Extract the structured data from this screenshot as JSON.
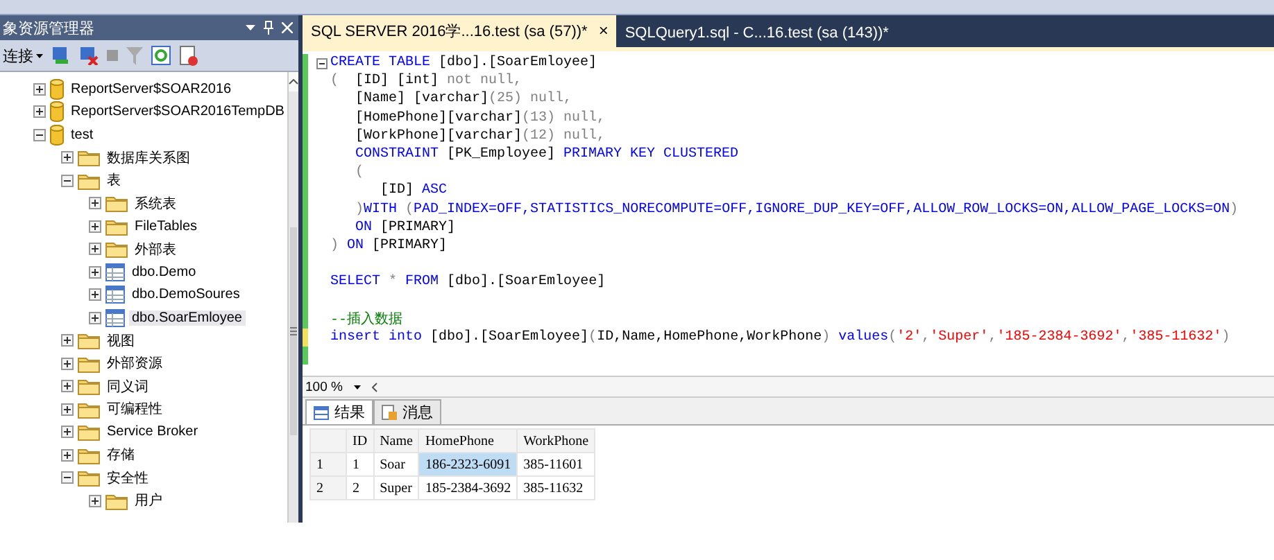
{
  "object_explorer": {
    "title": "象资源管理器",
    "connect_label": "连接",
    "tree": [
      {
        "label": "ReportServer$SOAR2016",
        "kind": "database",
        "expanded": false,
        "selected": false
      },
      {
        "label": "ReportServer$SOAR2016TempDB",
        "kind": "database",
        "expanded": false,
        "selected": false
      },
      {
        "label": "test",
        "kind": "database",
        "expanded": true,
        "selected": false,
        "children": [
          {
            "label": "数据库关系图",
            "kind": "folder",
            "expanded": false,
            "selected": false
          },
          {
            "label": "表",
            "kind": "folder",
            "expanded": true,
            "selected": false,
            "children": [
              {
                "label": "系统表",
                "kind": "folder",
                "expanded": false,
                "selected": false
              },
              {
                "label": "FileTables",
                "kind": "folder",
                "expanded": false,
                "selected": false
              },
              {
                "label": "外部表",
                "kind": "folder",
                "expanded": false,
                "selected": false
              },
              {
                "label": "dbo.Demo",
                "kind": "table",
                "expanded": false,
                "selected": false
              },
              {
                "label": "dbo.DemoSoures",
                "kind": "table",
                "expanded": false,
                "selected": false
              },
              {
                "label": "dbo.SoarEmloyee",
                "kind": "table",
                "expanded": false,
                "selected": true
              }
            ]
          },
          {
            "label": "视图",
            "kind": "folder",
            "expanded": false,
            "selected": false
          },
          {
            "label": "外部资源",
            "kind": "folder",
            "expanded": false,
            "selected": false
          },
          {
            "label": "同义词",
            "kind": "folder",
            "expanded": false,
            "selected": false
          },
          {
            "label": "可编程性",
            "kind": "folder",
            "expanded": false,
            "selected": false
          },
          {
            "label": "Service Broker",
            "kind": "folder",
            "expanded": false,
            "selected": false
          },
          {
            "label": "存储",
            "kind": "folder",
            "expanded": false,
            "selected": false
          },
          {
            "label": "安全性",
            "kind": "folder",
            "expanded": true,
            "selected": false,
            "children": [
              {
                "label": "用户",
                "kind": "folder",
                "expanded": false,
                "selected": false
              }
            ]
          }
        ]
      }
    ]
  },
  "tabs": [
    {
      "label": "SQL SERVER 2016学...16.test (sa (57))*",
      "close": "×",
      "selected": true
    },
    {
      "label": "SQLQuery1.sql - C...16.test (sa (143))*",
      "selected": false
    }
  ],
  "code_lines": [
    {
      "kind": "code",
      "saved": true,
      "tokens": [
        {
          "kind": "kw",
          "s": "CREATE TABLE"
        },
        {
          "kind": "plain",
          "s": " [dbo].[SoarEmloyee]"
        }
      ]
    },
    {
      "kind": "code",
      "saved": true,
      "tokens": [
        {
          "kind": "gray",
          "s": "(  "
        },
        {
          "kind": "plain",
          "s": "[ID] [int] "
        },
        {
          "kind": "gray",
          "s": "not null,"
        }
      ]
    },
    {
      "kind": "code",
      "saved": true,
      "tokens": [
        {
          "kind": "plain",
          "s": "   [Name] [varchar]"
        },
        {
          "kind": "gray",
          "s": "(25) null,"
        }
      ]
    },
    {
      "kind": "code",
      "saved": true,
      "tokens": [
        {
          "kind": "plain",
          "s": "   [HomePhone][varchar]"
        },
        {
          "kind": "gray",
          "s": "(13) null,"
        }
      ]
    },
    {
      "kind": "code",
      "saved": true,
      "tokens": [
        {
          "kind": "plain",
          "s": "   [WorkPhone][varchar]"
        },
        {
          "kind": "gray",
          "s": "(12) null,"
        }
      ]
    },
    {
      "kind": "code",
      "saved": true,
      "tokens": [
        {
          "kind": "kw",
          "s": "   CONSTRAINT"
        },
        {
          "kind": "plain",
          "s": " [PK_Employee] "
        },
        {
          "kind": "kw",
          "s": "PRIMARY KEY CLUSTERED"
        }
      ]
    },
    {
      "kind": "code",
      "saved": true,
      "tokens": [
        {
          "kind": "gray",
          "s": "   ("
        }
      ]
    },
    {
      "kind": "code",
      "saved": true,
      "tokens": [
        {
          "kind": "plain",
          "s": "      [ID] "
        },
        {
          "kind": "kw",
          "s": "ASC"
        }
      ]
    },
    {
      "kind": "code",
      "saved": true,
      "tokens": [
        {
          "kind": "gray",
          "s": "   )"
        },
        {
          "kind": "kw",
          "s": "WITH "
        },
        {
          "kind": "gray",
          "s": "("
        },
        {
          "kind": "kw",
          "s": "PAD_INDEX=OFF,STATISTICS_NORECOMPUTE=OFF,IGNORE_DUP_KEY=OFF,ALLOW_ROW_LOCKS=ON,ALLOW_PAGE_LOCKS=ON"
        },
        {
          "kind": "gray",
          "s": ")"
        }
      ]
    },
    {
      "kind": "code",
      "saved": true,
      "tokens": [
        {
          "kind": "kw",
          "s": "   ON"
        },
        {
          "kind": "plain",
          "s": " [PRIMARY]"
        }
      ]
    },
    {
      "kind": "code",
      "saved": true,
      "tokens": [
        {
          "kind": "gray",
          "s": ")"
        },
        {
          "kind": "kw",
          "s": " ON"
        },
        {
          "kind": "plain",
          "s": " [PRIMARY]"
        }
      ]
    },
    {
      "kind": "blank",
      "saved": true
    },
    {
      "kind": "code",
      "saved": true,
      "tokens": [
        {
          "kind": "kw",
          "s": "SELECT"
        },
        {
          "kind": "gray",
          "s": " * "
        },
        {
          "kind": "kw",
          "s": "FROM"
        },
        {
          "kind": "plain",
          "s": " [dbo].[SoarEmloyee]"
        }
      ]
    },
    {
      "kind": "blank",
      "saved": true
    },
    {
      "kind": "code",
      "saved": true,
      "tokens": [
        {
          "kind": "comment",
          "s": "--插入数据"
        }
      ]
    },
    {
      "kind": "code",
      "saved": false,
      "tokens": [
        {
          "kind": "kw",
          "s": "insert into"
        },
        {
          "kind": "plain",
          "s": " [dbo].[SoarEmloyee]"
        },
        {
          "kind": "gray",
          "s": "("
        },
        {
          "kind": "plain",
          "s": "ID,Name,HomePhone,WorkPhone"
        },
        {
          "kind": "gray",
          "s": ")"
        },
        {
          "kind": "kw",
          "s": " values"
        },
        {
          "kind": "gray",
          "s": "("
        },
        {
          "kind": "str",
          "s": "'2'"
        },
        {
          "kind": "gray",
          "s": ","
        },
        {
          "kind": "str",
          "s": "'Super'"
        },
        {
          "kind": "gray",
          "s": ","
        },
        {
          "kind": "str",
          "s": "'185-2384-3692'"
        },
        {
          "kind": "gray",
          "s": ","
        },
        {
          "kind": "str",
          "s": "'385-11632'"
        },
        {
          "kind": "gray",
          "s": ")"
        }
      ]
    },
    {
      "kind": "blank",
      "saved": true
    }
  ],
  "zoom": "100 %",
  "result_tabs": [
    {
      "label": "结果",
      "kind": "grid",
      "selected": true
    },
    {
      "label": "消息",
      "kind": "message",
      "selected": false
    }
  ],
  "grid": {
    "columns": [
      "ID",
      "Name",
      "HomePhone",
      "WorkPhone"
    ],
    "rows": [
      {
        "number": "1",
        "cells": [
          {
            "text": "1",
            "selected": false
          },
          {
            "text": "Soar",
            "selected": false
          },
          {
            "text": "186-2323-6091",
            "selected": true
          },
          {
            "text": "385-11601",
            "selected": false
          }
        ]
      },
      {
        "number": "2",
        "cells": [
          {
            "text": "2",
            "selected": false
          },
          {
            "text": "Super",
            "selected": false
          },
          {
            "text": "185-2384-3692",
            "selected": false
          },
          {
            "text": "385-11632",
            "selected": false
          }
        ]
      }
    ]
  }
}
